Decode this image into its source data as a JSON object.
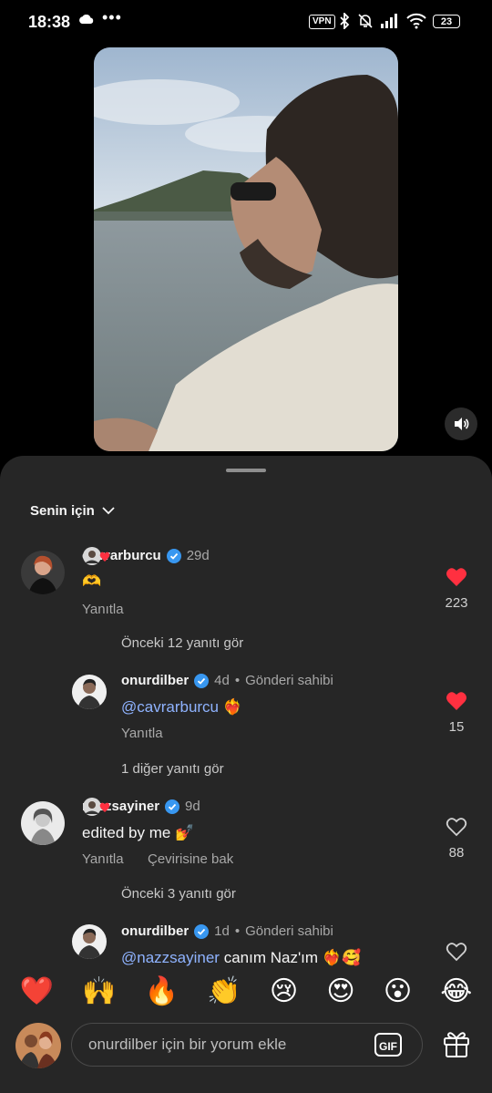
{
  "status_bar": {
    "time": "18:38",
    "dots": "•••",
    "vpn": "VPN",
    "battery": "23"
  },
  "comments_filter": "Senin için",
  "comments": [
    {
      "username": "cavrarburcu",
      "time": "29d",
      "text": "🫶",
      "reply_label": "Yanıtla",
      "likes": "223",
      "liked": true
    },
    {
      "more_replies": "Önceki 12 yanıtı gör"
    },
    {
      "username": "onurdilber",
      "time": "4d",
      "owner_label": "Gönderi sahibi",
      "mention": "@cavrarburcu",
      "text": "❤️‍🔥",
      "reply_label": "Yanıtla",
      "likes": "15",
      "liked": true
    },
    {
      "more_replies": "1 diğer yanıtı gör"
    },
    {
      "username": "nazzsayiner",
      "time": "9d",
      "text": "edited by me 💅",
      "reply_label": "Yanıtla",
      "translate_label": "Çevirisine bak",
      "likes": "88",
      "liked": false
    },
    {
      "more_replies": "Önceki 3 yanıtı gör"
    },
    {
      "username": "onurdilber",
      "time": "1d",
      "owner_label": "Gönderi sahibi",
      "mention": "@nazzsayiner",
      "text": " canım Naz'ım ❤️‍🔥🥰",
      "liked": false
    }
  ],
  "emoji_bar": [
    "❤️",
    "🙌",
    "🔥",
    "👏",
    "😢",
    "😍",
    "😮",
    "😂"
  ],
  "input": {
    "placeholder": "onurdilber için bir yorum ekle",
    "gif_label": "GIF"
  },
  "colors": {
    "like_red": "#ff3040",
    "verified_blue": "#3897f0",
    "mention_blue": "#8fb3ff",
    "sheet_bg": "#262626"
  },
  "icons": [
    "cloud-icon",
    "bluetooth-icon",
    "mute-bell-icon",
    "signal-icon",
    "wifi-icon",
    "battery-icon",
    "volume-icon",
    "chevron-down-icon",
    "verified-icon",
    "heart-icon",
    "gif-icon",
    "gift-icon"
  ]
}
